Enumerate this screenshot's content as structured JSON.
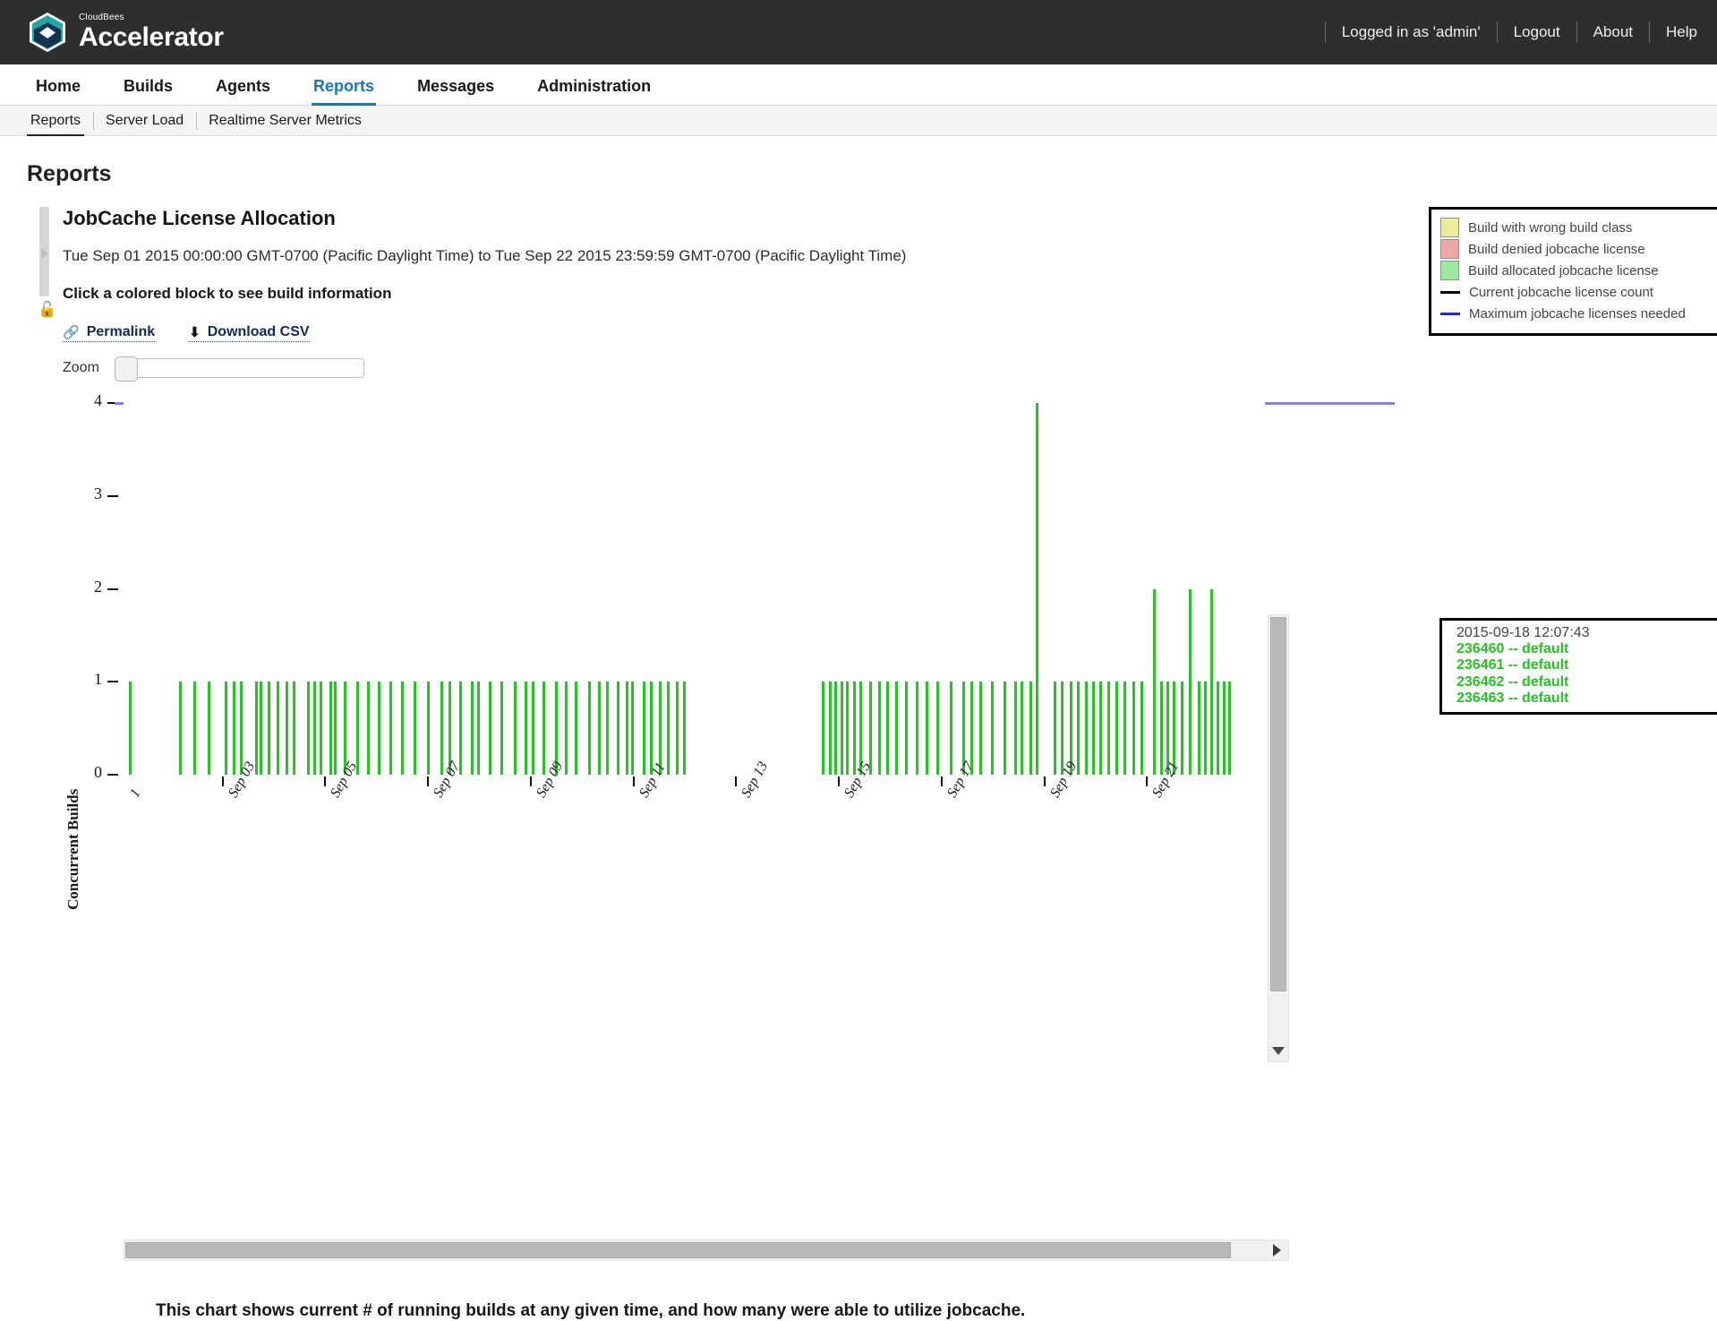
{
  "topbar": {
    "brand_small": "CloudBees",
    "brand_big": "Accelerator",
    "logo_icon": "cloudbees-hexagon-icon",
    "logged_in": "Logged in as 'admin'",
    "logout": "Logout",
    "about": "About",
    "help": "Help"
  },
  "mainnav": [
    {
      "label": "Home",
      "active": false
    },
    {
      "label": "Builds",
      "active": false
    },
    {
      "label": "Agents",
      "active": false
    },
    {
      "label": "Reports",
      "active": true
    },
    {
      "label": "Messages",
      "active": false
    },
    {
      "label": "Administration",
      "active": false
    }
  ],
  "subnav": [
    {
      "label": "Reports",
      "active": true
    },
    {
      "label": "Server Load",
      "active": false
    },
    {
      "label": "Realtime Server Metrics",
      "active": false
    }
  ],
  "page": {
    "title": "Reports"
  },
  "report": {
    "title": "JobCache License Allocation",
    "range": "Tue Sep 01 2015 00:00:00 GMT-0700 (Pacific Daylight Time) to Tue Sep 22 2015 23:59:59 GMT-0700 (Pacific Daylight Time)",
    "hint": "Click a colored block to see build information",
    "permalink": "Permalink",
    "permalink_icon": "link-icon",
    "download_csv": "Download CSV",
    "download_icon": "download-icon",
    "zoom_label": "Zoom",
    "zoom_value": "0",
    "caption": "This chart shows current # of running builds at any given time, and how many were able to utilize jobcache.",
    "collapse_icon": "chevron-right-icon",
    "lock_icon": "unlock-icon"
  },
  "legend": {
    "items": [
      {
        "type": "swatch",
        "color": "#ebeb9e",
        "label": "Build with wrong build class"
      },
      {
        "type": "swatch",
        "color": "#eda8a8",
        "label": "Build denied jobcache license"
      },
      {
        "type": "swatch",
        "color": "#9fe89f",
        "label": "Build allocated jobcache license"
      },
      {
        "type": "line",
        "color": "#000000",
        "label": "Current jobcache license count"
      },
      {
        "type": "line",
        "color": "#2222e0",
        "label": "Maximum jobcache licenses needed"
      }
    ]
  },
  "tooltip": {
    "timestamp": "2015-09-18 12:07:43",
    "builds": [
      "236460 -- default",
      "236461 -- default",
      "236462 -- default",
      "236463 -- default"
    ],
    "build_color": "#22c522"
  },
  "chart_data": {
    "type": "bar",
    "title": "JobCache License Allocation",
    "xlabel": "",
    "ylabel": "Concurrent Builds",
    "ylim": [
      0,
      4.1
    ],
    "yticks": [
      0,
      1,
      2,
      3,
      4
    ],
    "ytick_labels": [
      "0",
      "1",
      "2",
      "3",
      "4"
    ],
    "grid": false,
    "legend_position": "top-right",
    "xtick_labels": [
      "Sep 03",
      "Sep 05",
      "Sep 07",
      "Sep 09",
      "Sep 11",
      "Sep 13",
      "Sep 15",
      "Sep 17",
      "Sep 19",
      "Sep 21"
    ],
    "xtick_positions_pct": [
      8.6,
      17.6,
      26.6,
      35.6,
      44.6,
      53.6,
      62.6,
      71.6,
      80.6,
      89.6
    ],
    "x_range": [
      "2015-09-01 00:00:00",
      "2015-09-22 23:59:59"
    ],
    "series": [
      {
        "name": "Build allocated jobcache license",
        "color": "#22c522",
        "note": "Each bar is a concurrent-build count sample at one timestamp.",
        "bars_pct_value": [
          [
            0.5,
            1
          ],
          [
            4.9,
            1
          ],
          [
            6.1,
            1
          ],
          [
            7.4,
            1
          ],
          [
            8.9,
            1
          ],
          [
            9.6,
            1
          ],
          [
            10.2,
            1
          ],
          [
            11.5,
            1
          ],
          [
            11.9,
            1
          ],
          [
            12.6,
            1
          ],
          [
            13.4,
            1
          ],
          [
            14.2,
            1
          ],
          [
            14.8,
            1
          ],
          [
            16.1,
            1
          ],
          [
            16.6,
            1
          ],
          [
            17.2,
            1
          ],
          [
            18.0,
            1
          ],
          [
            18.4,
            1
          ],
          [
            19.3,
            1
          ],
          [
            20.4,
            1
          ],
          [
            21.3,
            1
          ],
          [
            22.3,
            1
          ],
          [
            23.3,
            1
          ],
          [
            24.3,
            1
          ],
          [
            25.4,
            1
          ],
          [
            26.6,
            1
          ],
          [
            27.8,
            1
          ],
          [
            28.5,
            1
          ],
          [
            29.4,
            1
          ],
          [
            30.4,
            1
          ],
          [
            31.0,
            1
          ],
          [
            32.0,
            1
          ],
          [
            33.0,
            1
          ],
          [
            34.2,
            1
          ],
          [
            35.1,
            1
          ],
          [
            35.8,
            1
          ],
          [
            36.7,
            1
          ],
          [
            37.8,
            1
          ],
          [
            38.7,
            1
          ],
          [
            39.5,
            1
          ],
          [
            40.7,
            1
          ],
          [
            41.6,
            1
          ],
          [
            42.3,
            1
          ],
          [
            43.2,
            1
          ],
          [
            44.0,
            1
          ],
          [
            44.5,
            1
          ],
          [
            45.5,
            1
          ],
          [
            46.1,
            1
          ],
          [
            46.9,
            1
          ],
          [
            47.6,
            1
          ],
          [
            48.4,
            1
          ],
          [
            49.0,
            1
          ],
          [
            61.2,
            1
          ],
          [
            61.8,
            1
          ],
          [
            62.3,
            1
          ],
          [
            62.8,
            1
          ],
          [
            63.3,
            1
          ],
          [
            63.9,
            1
          ],
          [
            64.5,
            1
          ],
          [
            65.3,
            1
          ],
          [
            66.1,
            1
          ],
          [
            66.8,
            1
          ],
          [
            67.6,
            1
          ],
          [
            68.5,
            1
          ],
          [
            69.4,
            1
          ],
          [
            70.3,
            1
          ],
          [
            71.2,
            1
          ],
          [
            72.4,
            1
          ],
          [
            73.5,
            1
          ],
          [
            74.2,
            1
          ],
          [
            75.0,
            1
          ],
          [
            76.0,
            1
          ],
          [
            77.1,
            1
          ],
          [
            78.0,
            1
          ],
          [
            78.6,
            1
          ],
          [
            79.4,
            1
          ],
          [
            79.9,
            4
          ],
          [
            81.5,
            1
          ],
          [
            82.1,
            1
          ],
          [
            82.9,
            1
          ],
          [
            83.5,
            1
          ],
          [
            84.2,
            1
          ],
          [
            84.9,
            1
          ],
          [
            85.5,
            1
          ],
          [
            86.2,
            1
          ],
          [
            86.9,
            1
          ],
          [
            87.6,
            1
          ],
          [
            88.4,
            1
          ],
          [
            89.1,
            1
          ],
          [
            90.2,
            2
          ],
          [
            90.8,
            1
          ],
          [
            91.4,
            1
          ],
          [
            91.9,
            1
          ],
          [
            92.6,
            1
          ],
          [
            93.3,
            2
          ],
          [
            94.1,
            1
          ],
          [
            94.7,
            1
          ],
          [
            95.2,
            2
          ],
          [
            95.8,
            1
          ],
          [
            96.3,
            1
          ],
          [
            96.8,
            1
          ]
        ]
      },
      {
        "name": "Maximum jobcache licenses needed",
        "type": "hline",
        "color": "#8080f4",
        "value": 4
      }
    ]
  },
  "scrollbars": {
    "vertical_down_icon": "triangle-down-icon",
    "horizontal_right_icon": "triangle-right-icon"
  }
}
